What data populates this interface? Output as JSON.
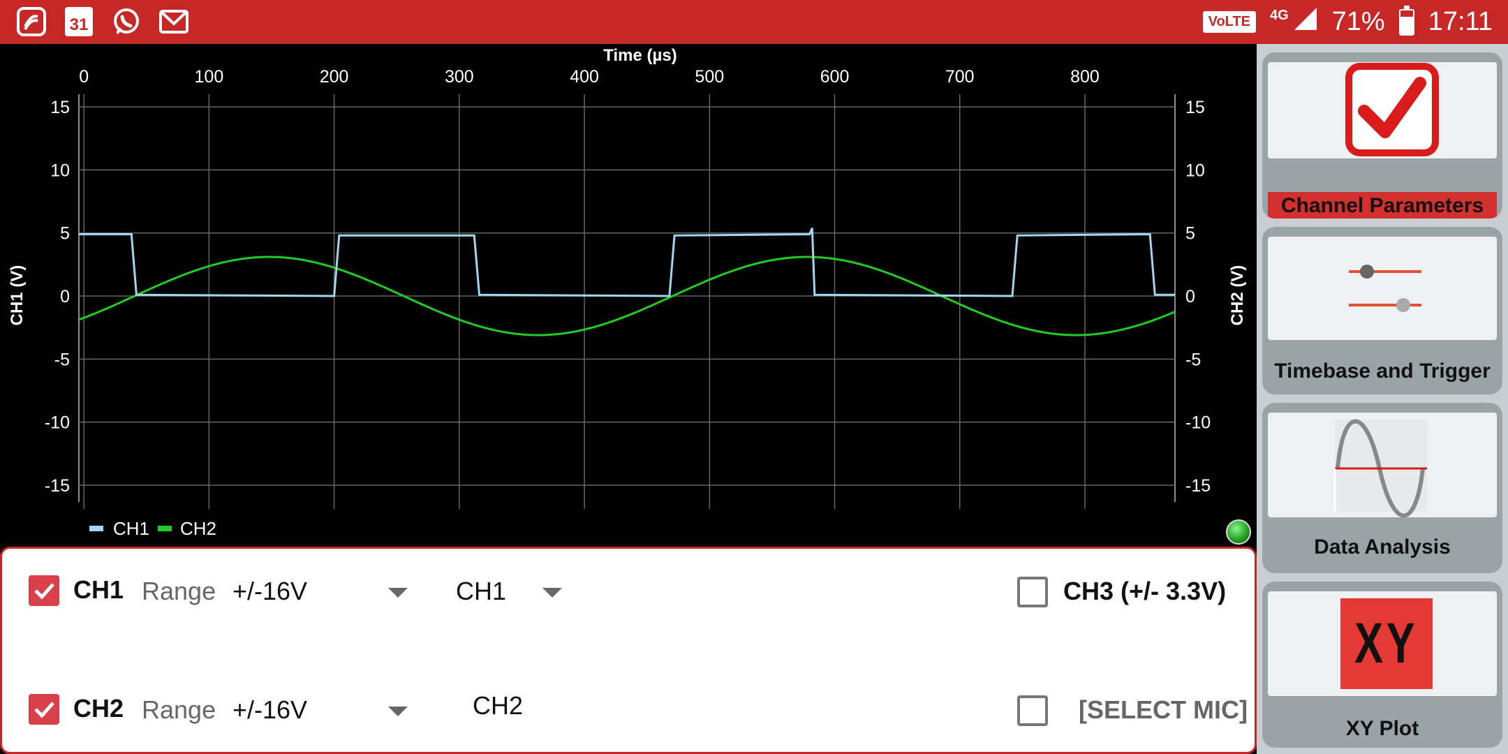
{
  "status_bar": {
    "left_icons": [
      "saavn-icon",
      "calendar-icon",
      "whatsapp-icon",
      "gmail-icon"
    ],
    "calendar_day": "31",
    "volte": "VoLTE",
    "network": "4G",
    "battery_percent": "71%",
    "battery_level": 0.71,
    "time": "17:11"
  },
  "chart_data": {
    "type": "line",
    "title": "",
    "xlabel": "Time   (µs)",
    "ylabel": "CH1 (V)",
    "y2label": "CH2 (V)",
    "x_ticks": [
      "0",
      "100",
      "200",
      "300",
      "400",
      "500",
      "600",
      "700",
      "800"
    ],
    "y_ticks": [
      "15",
      "10",
      "5",
      "0",
      "-5",
      "-10",
      "-15"
    ],
    "xlim": [
      -4,
      872
    ],
    "ylim": [
      -16,
      16
    ],
    "grid": true,
    "legend_position": "bottom-left",
    "series": [
      {
        "name": "CH1",
        "color": "#9fd8f0",
        "shape": "square",
        "x": [
          -4,
          38,
          42,
          200,
          204,
          312,
          316,
          468,
          472,
          580,
          582,
          584,
          742,
          746,
          852,
          856,
          872
        ],
        "y": [
          4.9,
          4.9,
          0.1,
          0.0,
          4.8,
          4.8,
          0.1,
          0.0,
          4.8,
          4.9,
          5.4,
          0.1,
          0.0,
          4.8,
          4.9,
          0.1,
          0.1
        ]
      },
      {
        "name": "CH2",
        "color": "#22cc22",
        "shape": "sine",
        "amplitude": 3.1,
        "period_us": 430,
        "peak_at_us": 148
      }
    ]
  },
  "side_panel": {
    "cards": [
      {
        "label": "Channel Parameters",
        "icon": "checkmark-icon",
        "active": true
      },
      {
        "label": "Timebase and Trigger",
        "icon": "sliders-icon",
        "active": false
      },
      {
        "label": "Data Analysis",
        "icon": "sine-wave-icon",
        "active": false
      },
      {
        "label": "XY Plot",
        "icon": "xy-icon",
        "icon_text": "XY",
        "active": false
      }
    ]
  },
  "controls": {
    "ch1": {
      "checked": true,
      "name": "CH1",
      "range_label": "Range",
      "range_value": "+/-16V",
      "map_value": "CH1"
    },
    "ch2": {
      "checked": true,
      "name": "CH2",
      "range_label": "Range",
      "range_value": "+/-16V",
      "map_value": "CH2"
    },
    "ch3": {
      "checked": false,
      "label": "CH3 (+/- 3.3V)"
    },
    "mic": {
      "checked": false,
      "label": "[SELECT MIC]"
    }
  }
}
